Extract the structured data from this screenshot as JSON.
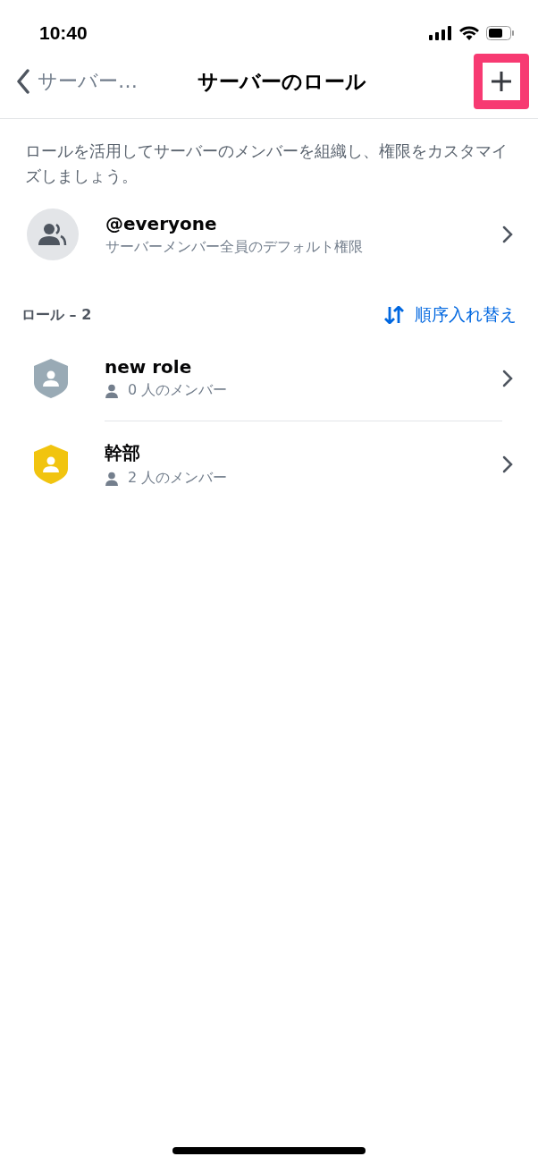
{
  "status_bar": {
    "time": "10:40"
  },
  "nav": {
    "back_label": "サーバー…",
    "title": "サーバーのロール",
    "add_highlighted": true
  },
  "description": "ロールを活用してサーバーのメンバーを組織し、権限をカスタマイズしましょう。",
  "everyone": {
    "name": "@everyone",
    "subtitle": "サーバーメンバー全員のデフォルト権限"
  },
  "roles_header": {
    "label": "ロール – 2",
    "reorder": "順序入れ替え"
  },
  "roles": [
    {
      "name": "new role",
      "members": "0 人のメンバー",
      "color": "#99aab5"
    },
    {
      "name": "幹部",
      "members": "2 人のメンバー",
      "color": "#f1c40f"
    }
  ]
}
